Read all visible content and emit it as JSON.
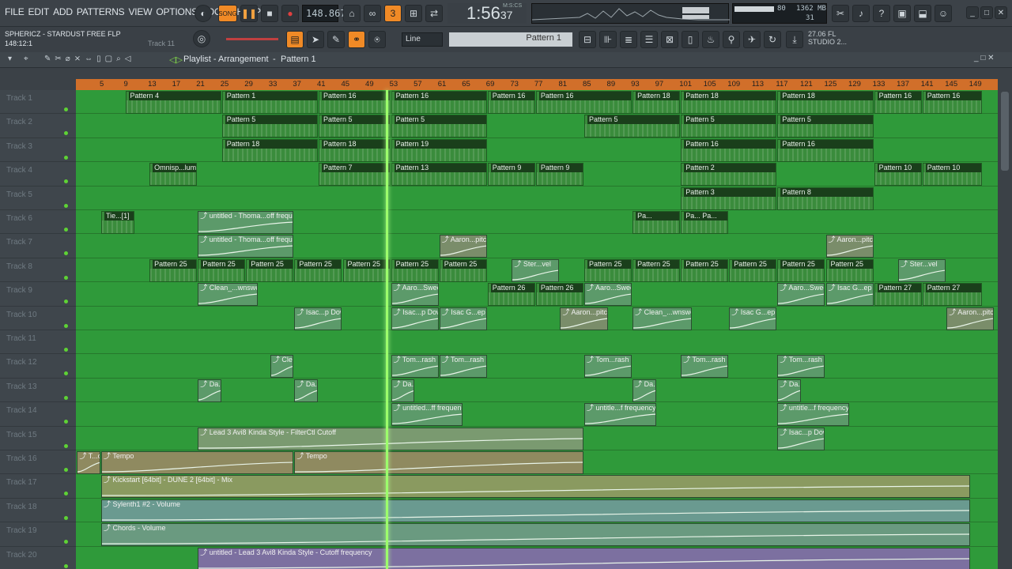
{
  "menu": [
    "FILE",
    "EDIT",
    "ADD",
    "PATTERNS",
    "VIEW",
    "OPTIONS",
    "TOOLS",
    "HELP"
  ],
  "transport": {
    "song_label": "SONG",
    "tempo": "148.867",
    "time": "1:56",
    "time_small": "37",
    "time_label": "M:S:CS"
  },
  "project": {
    "title": "SPHERICZ - STARDUST FREE FLP",
    "position": "148:12:1",
    "track_hint": "Track 11"
  },
  "toolbar": {
    "snap_label": "Line",
    "pattern_label": "Pattern 1",
    "version": "27.06",
    "version_b": "STUDIO 2...",
    "fl": "FL",
    "cpu": "80",
    "mem": "1362 MB",
    "poly": "31"
  },
  "playlist": {
    "title": "Playlist - Arrangement",
    "pattern": "Pattern 1"
  },
  "ruler": [
    "5",
    "9",
    "13",
    "17",
    "21",
    "25",
    "29",
    "33",
    "37",
    "41",
    "45",
    "49",
    "53",
    "57",
    "61",
    "65",
    "69",
    "73",
    "77",
    "81",
    "85",
    "89",
    "93",
    "97",
    "101",
    "105",
    "109",
    "113",
    "117",
    "121",
    "125",
    "129",
    "133",
    "137",
    "141",
    "145",
    "149"
  ],
  "tracks": [
    "Track 1",
    "Track 2",
    "Track 3",
    "Track 4",
    "Track 5",
    "Track 6",
    "Track 7",
    "Track 8",
    "Track 9",
    "Track 10",
    "Track 11",
    "Track 12",
    "Track 13",
    "Track 14",
    "Track 15",
    "Track 16",
    "Track 17",
    "Track 18",
    "Track 19",
    "Track 20"
  ],
  "clips": [
    {
      "t": 0,
      "s": 2,
      "e": 6,
      "n": "Pattern 4"
    },
    {
      "t": 0,
      "s": 6,
      "e": 10,
      "n": "Pattern 1"
    },
    {
      "t": 0,
      "s": 10,
      "e": 13,
      "n": "Pattern 16"
    },
    {
      "t": 0,
      "s": 13,
      "e": 17,
      "n": "Pattern 16"
    },
    {
      "t": 0,
      "s": 17,
      "e": 19,
      "n": "Pattern 16"
    },
    {
      "t": 0,
      "s": 19,
      "e": 23,
      "n": "Pattern 16"
    },
    {
      "t": 0,
      "s": 23,
      "e": 25,
      "n": "Pattern 18"
    },
    {
      "t": 0,
      "s": 25,
      "e": 29,
      "n": "Pattern 18"
    },
    {
      "t": 0,
      "s": 29,
      "e": 33,
      "n": "Pattern 18"
    },
    {
      "t": 0,
      "s": 33,
      "e": 35,
      "n": "Pattern 16"
    },
    {
      "t": 0,
      "s": 35,
      "e": 37.5,
      "n": "Pattern 16"
    },
    {
      "t": 1,
      "s": 6,
      "e": 10,
      "n": "Pattern 5"
    },
    {
      "t": 1,
      "s": 10,
      "e": 13,
      "n": "Pattern 5"
    },
    {
      "t": 1,
      "s": 13,
      "e": 17,
      "n": "Pattern 5"
    },
    {
      "t": 1,
      "s": 21,
      "e": 25,
      "n": "Pattern 5"
    },
    {
      "t": 1,
      "s": 25,
      "e": 29,
      "n": "Pattern 5"
    },
    {
      "t": 1,
      "s": 29,
      "e": 33,
      "n": "Pattern 5"
    },
    {
      "t": 2,
      "s": 6,
      "e": 10,
      "n": "Pattern 18"
    },
    {
      "t": 2,
      "s": 10,
      "e": 13,
      "n": "Pattern 18"
    },
    {
      "t": 2,
      "s": 13,
      "e": 17,
      "n": "Pattern 19"
    },
    {
      "t": 2,
      "s": 25,
      "e": 29,
      "n": "Pattern 16"
    },
    {
      "t": 2,
      "s": 29,
      "e": 33,
      "n": "Pattern 16"
    },
    {
      "t": 3,
      "s": 3,
      "e": 5,
      "n": "Omnisp...lume"
    },
    {
      "t": 3,
      "s": 10,
      "e": 13,
      "n": "Pattern 7"
    },
    {
      "t": 3,
      "s": 13,
      "e": 17,
      "n": "Pattern 13"
    },
    {
      "t": 3,
      "s": 17,
      "e": 19,
      "n": "Pattern 9"
    },
    {
      "t": 3,
      "s": 19,
      "e": 21,
      "n": "Pattern 9"
    },
    {
      "t": 3,
      "s": 25,
      "e": 29,
      "n": "Pattern 2"
    },
    {
      "t": 3,
      "s": 33,
      "e": 35,
      "n": "Pattern 10"
    },
    {
      "t": 3,
      "s": 35,
      "e": 37.5,
      "n": "Pattern 10"
    },
    {
      "t": 4,
      "s": 25,
      "e": 29,
      "n": "Pattern 3"
    },
    {
      "t": 4,
      "s": 29,
      "e": 33,
      "n": "Pattern 8"
    },
    {
      "t": 5,
      "s": 1,
      "e": 2.4,
      "n": "Tie...[1]"
    },
    {
      "t": 5,
      "s": 23,
      "e": 25,
      "n": "Pa..."
    },
    {
      "t": 5,
      "s": 25,
      "e": 27,
      "n": "Pa... Pa..."
    },
    {
      "t": 7,
      "s": 3,
      "e": 5,
      "n": "Pattern 25"
    },
    {
      "t": 7,
      "s": 5,
      "e": 7,
      "n": "Pattern 25"
    },
    {
      "t": 7,
      "s": 7,
      "e": 9,
      "n": "Pattern 25"
    },
    {
      "t": 7,
      "s": 9,
      "e": 11,
      "n": "Pattern 25"
    },
    {
      "t": 7,
      "s": 11,
      "e": 13,
      "n": "Pattern 25"
    },
    {
      "t": 7,
      "s": 13,
      "e": 15,
      "n": "Pattern 25"
    },
    {
      "t": 7,
      "s": 15,
      "e": 17,
      "n": "Pattern 25"
    },
    {
      "t": 7,
      "s": 21,
      "e": 23,
      "n": "Pattern 25"
    },
    {
      "t": 7,
      "s": 23,
      "e": 25,
      "n": "Pattern 25"
    },
    {
      "t": 7,
      "s": 25,
      "e": 27,
      "n": "Pattern 25"
    },
    {
      "t": 7,
      "s": 27,
      "e": 29,
      "n": "Pattern 25"
    },
    {
      "t": 7,
      "s": 29,
      "e": 31,
      "n": "Pattern 25"
    },
    {
      "t": 7,
      "s": 31,
      "e": 33,
      "n": "Pattern 25"
    },
    {
      "t": 8,
      "s": 17,
      "e": 19,
      "n": "Pattern 26"
    },
    {
      "t": 8,
      "s": 19,
      "e": 21,
      "n": "Pattern 26"
    },
    {
      "t": 8,
      "s": 33,
      "e": 35,
      "n": "Pattern 27"
    },
    {
      "t": 8,
      "s": 35,
      "e": 37.5,
      "n": "Pattern 27"
    }
  ],
  "autos": [
    {
      "t": 5,
      "s": 5,
      "e": 9,
      "n": "untitled - Thoma...off frequency",
      "c": "#5c9a6a"
    },
    {
      "t": 6,
      "s": 5,
      "e": 9,
      "n": "untitled - Thoma...off frequency",
      "c": "#5c9a6a"
    },
    {
      "t": 6,
      "s": 15,
      "e": 17,
      "n": "Aaron...pitch",
      "c": "#7a8d6a"
    },
    {
      "t": 6,
      "s": 31,
      "e": 33,
      "n": "Aaron...pitch",
      "c": "#7a8d6a"
    },
    {
      "t": 7,
      "s": 18,
      "e": 20,
      "n": "Ster...vel",
      "c": "#5c9a6a"
    },
    {
      "t": 7,
      "s": 34,
      "e": 36,
      "n": "Ster...vel",
      "c": "#5c9a6a"
    },
    {
      "t": 8,
      "s": 5,
      "e": 7.5,
      "n": "Clean_...wnsweep",
      "c": "#5c9a6a"
    },
    {
      "t": 8,
      "s": 13,
      "e": 15,
      "n": "Aaro...Sweep",
      "c": "#5c9a6a"
    },
    {
      "t": 8,
      "s": 21,
      "e": 23,
      "n": "Aaro...Sweep",
      "c": "#5c9a6a"
    },
    {
      "t": 8,
      "s": 29,
      "e": 31,
      "n": "Aaro...Swee",
      "c": "#5c9a6a"
    },
    {
      "t": 8,
      "s": 31,
      "e": 33,
      "n": "Isac G...ep Up",
      "c": "#5c9a6a"
    },
    {
      "t": 9,
      "s": 9,
      "e": 11,
      "n": "Isac...p Down",
      "c": "#5c9a6a"
    },
    {
      "t": 9,
      "s": 13,
      "e": 15,
      "n": "Isac...p Down",
      "c": "#5c9a6a"
    },
    {
      "t": 9,
      "s": 15,
      "e": 17,
      "n": "Isac G...ep Up",
      "c": "#5c9a6a"
    },
    {
      "t": 9,
      "s": 20,
      "e": 22,
      "n": "Aaron...pitch",
      "c": "#7a8d6a"
    },
    {
      "t": 9,
      "s": 23,
      "e": 25.5,
      "n": "Clean_...wnsweep",
      "c": "#5c9a6a"
    },
    {
      "t": 9,
      "s": 27,
      "e": 29,
      "n": "Isac G...ep Up",
      "c": "#5c9a6a"
    },
    {
      "t": 9,
      "s": 36,
      "e": 38,
      "n": "Aaron...pitch",
      "c": "#7a8d6a"
    },
    {
      "t": 11,
      "s": 8,
      "e": 9,
      "n": "Cle...#2",
      "c": "#5c9a6a"
    },
    {
      "t": 11,
      "s": 13,
      "e": 15,
      "n": "Tom...rash",
      "c": "#5c9a6a"
    },
    {
      "t": 11,
      "s": 15,
      "e": 17,
      "n": "Tom...rash",
      "c": "#5c9a6a"
    },
    {
      "t": 11,
      "s": 21,
      "e": 23,
      "n": "Tom...rash",
      "c": "#5c9a6a"
    },
    {
      "t": 11,
      "s": 25,
      "e": 27,
      "n": "Tom...rash",
      "c": "#5c9a6a"
    },
    {
      "t": 11,
      "s": 29,
      "e": 31,
      "n": "Tom...rash",
      "c": "#5c9a6a"
    },
    {
      "t": 12,
      "s": 5,
      "e": 6,
      "n": "Da...t",
      "c": "#5c9a6a"
    },
    {
      "t": 12,
      "s": 9,
      "e": 10,
      "n": "Da...t",
      "c": "#5c9a6a"
    },
    {
      "t": 12,
      "s": 13,
      "e": 14,
      "n": "Da...t",
      "c": "#5c9a6a"
    },
    {
      "t": 12,
      "s": 23,
      "e": 24,
      "n": "Da...t",
      "c": "#5c9a6a"
    },
    {
      "t": 12,
      "s": 29,
      "e": 30,
      "n": "Da...t",
      "c": "#5c9a6a"
    },
    {
      "t": 13,
      "s": 13,
      "e": 16,
      "n": "untitled...ff frequency",
      "c": "#5c9a6a"
    },
    {
      "t": 13,
      "s": 21,
      "e": 24,
      "n": "untitle...f frequency",
      "c": "#5c9a6a"
    },
    {
      "t": 13,
      "s": 29,
      "e": 32,
      "n": "untitle...f frequency",
      "c": "#5c9a6a"
    },
    {
      "t": 14,
      "s": 5,
      "e": 21,
      "n": "Lead 3 Avi8 Kinda Style - FilterCtl Cutoff",
      "c": "#7a9a70"
    },
    {
      "t": 14,
      "s": 29,
      "e": 31,
      "n": "Isac...p Down",
      "c": "#5c9a6a"
    },
    {
      "t": 15,
      "s": 0,
      "e": 1,
      "n": "T...o",
      "c": "#8f8a60"
    },
    {
      "t": 15,
      "s": 1,
      "e": 9,
      "n": "Tempo",
      "c": "#8f8a60"
    },
    {
      "t": 15,
      "s": 9,
      "e": 21,
      "n": "Tempo",
      "c": "#8f8a60"
    },
    {
      "t": 16,
      "s": 1,
      "e": 37,
      "n": "Kickstart [64bit] - DUNE 2 [64bit] - Mix",
      "c": "#8a9a60"
    },
    {
      "t": 17,
      "s": 1,
      "e": 37,
      "n": "Sylenth1 #2 - Volume",
      "c": "#6a9a90"
    },
    {
      "t": 18,
      "s": 1,
      "e": 37,
      "n": "Chords - Volume",
      "c": "#6a9a80"
    },
    {
      "t": 19,
      "s": 5,
      "e": 37,
      "n": "untitled - Lead 3 Avi8 Kinda Style - Cutoff frequency",
      "c": "#7c70a0"
    }
  ]
}
